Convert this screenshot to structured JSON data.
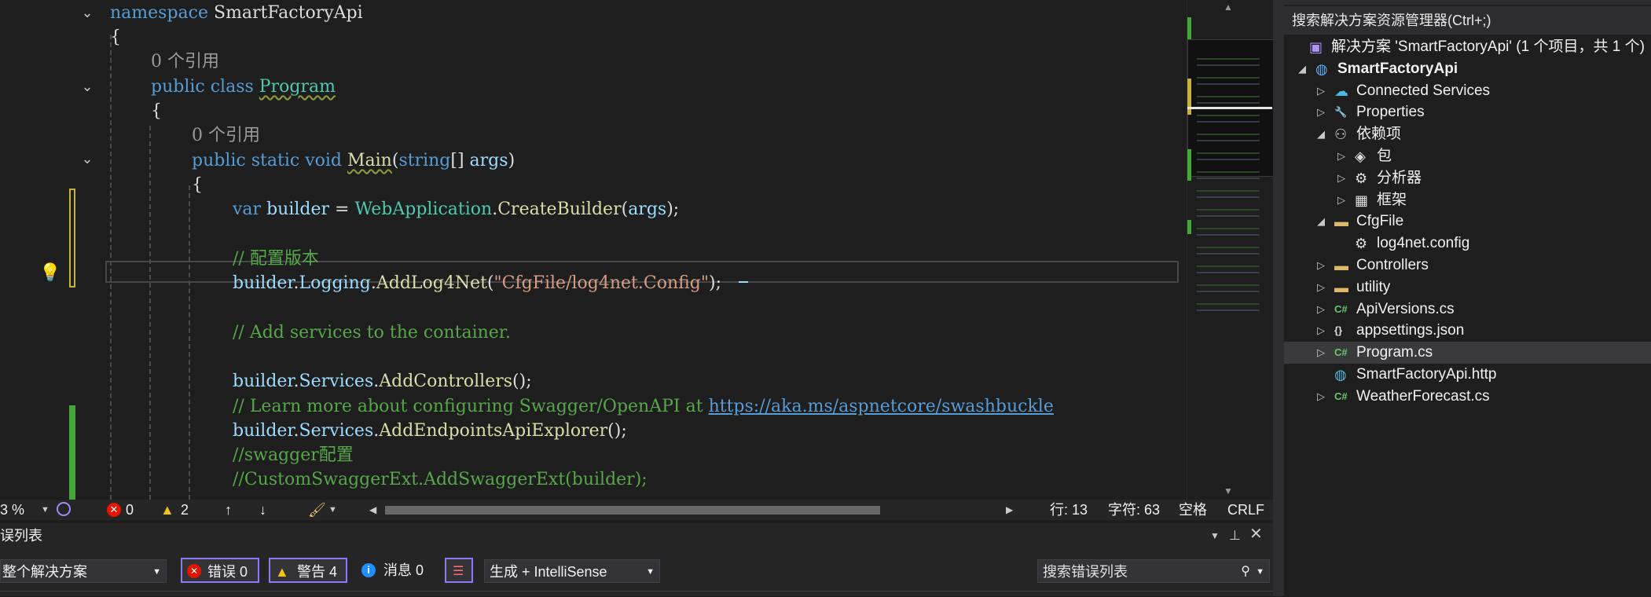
{
  "editor": {
    "lines": [
      {
        "ref": "",
        "parts": [
          [
            "kw",
            "namespace"
          ],
          [
            "plain",
            " SmartFactoryApi"
          ]
        ]
      },
      {
        "ref": "",
        "parts": [
          [
            "plain",
            "{"
          ]
        ]
      },
      {
        "ref": "0 个引用",
        "parts": []
      },
      {
        "ref": "",
        "parts": [
          [
            "kw",
            "public"
          ],
          [
            "plain",
            " "
          ],
          [
            "kw",
            "class"
          ],
          [
            "plain",
            " "
          ],
          [
            "cls squig",
            "Program"
          ]
        ]
      },
      {
        "ref": "",
        "parts": [
          [
            "plain",
            "{"
          ]
        ]
      },
      {
        "ref": "0 个引用",
        "parts": []
      },
      {
        "ref": "",
        "parts": [
          [
            "kw",
            "public"
          ],
          [
            "plain",
            " "
          ],
          [
            "kw",
            "static"
          ],
          [
            "plain",
            " "
          ],
          [
            "kw",
            "void"
          ],
          [
            "plain",
            " "
          ],
          [
            "fn squig",
            "Main"
          ],
          [
            "plain",
            "("
          ],
          [
            "kw",
            "string"
          ],
          [
            "plain",
            "[] "
          ],
          [
            "var",
            "args"
          ],
          [
            "plain",
            ")"
          ]
        ]
      },
      {
        "ref": "",
        "parts": [
          [
            "plain",
            "{"
          ]
        ]
      },
      {
        "ref": "",
        "parts": [
          [
            "kw",
            "var"
          ],
          [
            "plain",
            " "
          ],
          [
            "var",
            "builder"
          ],
          [
            "plain",
            " = "
          ],
          [
            "cls",
            "WebApplication"
          ],
          [
            "plain",
            "."
          ],
          [
            "fn",
            "CreateBuilder"
          ],
          [
            "plain",
            "("
          ],
          [
            "var",
            "args"
          ],
          [
            "plain",
            ");"
          ]
        ]
      },
      {
        "ref": "",
        "parts": []
      },
      {
        "ref": "",
        "parts": [
          [
            "cmt",
            "// 配置版本"
          ]
        ]
      },
      {
        "ref": "",
        "parts": [
          [
            "var",
            "builder"
          ],
          [
            "plain",
            "."
          ],
          [
            "var",
            "Logging"
          ],
          [
            "plain",
            "."
          ],
          [
            "fn",
            "AddLog4Net"
          ],
          [
            "plain",
            "("
          ],
          [
            "str",
            "\"CfgFile/log4net.Config\""
          ],
          [
            "plain",
            ");"
          ]
        ]
      },
      {
        "ref": "",
        "parts": []
      },
      {
        "ref": "",
        "parts": [
          [
            "cmt",
            "// Add services to the container."
          ]
        ]
      },
      {
        "ref": "",
        "parts": []
      },
      {
        "ref": "",
        "parts": [
          [
            "var",
            "builder"
          ],
          [
            "plain",
            "."
          ],
          [
            "var",
            "Services"
          ],
          [
            "plain",
            "."
          ],
          [
            "fn",
            "AddControllers"
          ],
          [
            "plain",
            "();"
          ]
        ]
      },
      {
        "ref": "",
        "parts": [
          [
            "cmt",
            "// Learn more about configuring Swagger/OpenAPI at "
          ],
          [
            "link",
            "https://aka.ms/aspnetcore/swashbuckle"
          ]
        ]
      },
      {
        "ref": "",
        "parts": [
          [
            "var",
            "builder"
          ],
          [
            "plain",
            "."
          ],
          [
            "var",
            "Services"
          ],
          [
            "plain",
            "."
          ],
          [
            "fn",
            "AddEndpointsApiExplorer"
          ],
          [
            "plain",
            "();"
          ]
        ]
      },
      {
        "ref": "",
        "parts": [
          [
            "cmt",
            "//swagger配置"
          ]
        ]
      },
      {
        "ref": "",
        "parts": [
          [
            "cmt",
            "//CustomSwaggerExt.AddSwaggerExt(builder);"
          ]
        ]
      }
    ]
  },
  "status": {
    "zoom": "3 %",
    "errors": "0",
    "warnings": "2",
    "line": "行: 13",
    "char": "字符: 63",
    "space": "空格",
    "eol": "CRLF"
  },
  "errorlist": {
    "title": "误列表",
    "scope": "整个解决方案",
    "errors_btn": "错误 0",
    "warnings_btn": "警告 4",
    "messages_btn": "消息 0",
    "build_filter": "生成 + IntelliSense",
    "search_placeholder": "搜索错误列表"
  },
  "solution_explorer": {
    "search_placeholder": "搜索解决方案资源管理器(Ctrl+;)",
    "items": [
      {
        "label": "解决方案 'SmartFactoryApi' (1 个项目，共 1 个)",
        "icon": "solution-icon",
        "level": 0,
        "arrow": "",
        "bold": false
      },
      {
        "label": "SmartFactoryApi",
        "icon": "web-project-icon",
        "level": 0,
        "arrow": "expanded",
        "bold": true
      },
      {
        "label": "Connected Services",
        "icon": "connected-services-icon",
        "level": 1,
        "arrow": "collapsed",
        "bold": false
      },
      {
        "label": "Properties",
        "icon": "properties-icon",
        "level": 1,
        "arrow": "collapsed",
        "bold": false
      },
      {
        "label": "依赖项",
        "icon": "dependencies-icon",
        "level": 1,
        "arrow": "expanded",
        "bold": false
      },
      {
        "label": "包",
        "icon": "package-icon",
        "level": 2,
        "arrow": "collapsed",
        "bold": false
      },
      {
        "label": "分析器",
        "icon": "analyzer-icon",
        "level": 2,
        "arrow": "collapsed",
        "bold": false
      },
      {
        "label": "框架",
        "icon": "framework-icon",
        "level": 2,
        "arrow": "collapsed",
        "bold": false
      },
      {
        "label": "CfgFile",
        "icon": "folder-icon",
        "level": 1,
        "arrow": "expanded",
        "bold": false
      },
      {
        "label": "log4net.config",
        "icon": "config-file-icon",
        "level": 2,
        "arrow": "",
        "bold": false
      },
      {
        "label": "Controllers",
        "icon": "folder-icon",
        "level": 1,
        "arrow": "collapsed",
        "bold": false
      },
      {
        "label": "utility",
        "icon": "folder-icon",
        "level": 1,
        "arrow": "collapsed",
        "bold": false
      },
      {
        "label": "ApiVersions.cs",
        "icon": "csharp-file-icon",
        "level": 1,
        "arrow": "collapsed",
        "bold": false
      },
      {
        "label": "appsettings.json",
        "icon": "json-file-icon",
        "level": 1,
        "arrow": "collapsed",
        "bold": false
      },
      {
        "label": "Program.cs",
        "icon": "csharp-file-icon",
        "level": 1,
        "arrow": "collapsed",
        "bold": false,
        "selected": true
      },
      {
        "label": "SmartFactoryApi.http",
        "icon": "http-file-icon",
        "level": 1,
        "arrow": "",
        "bold": false
      },
      {
        "label": "WeatherForecast.cs",
        "icon": "csharp-file-icon",
        "level": 1,
        "arrow": "collapsed",
        "bold": false
      }
    ]
  }
}
